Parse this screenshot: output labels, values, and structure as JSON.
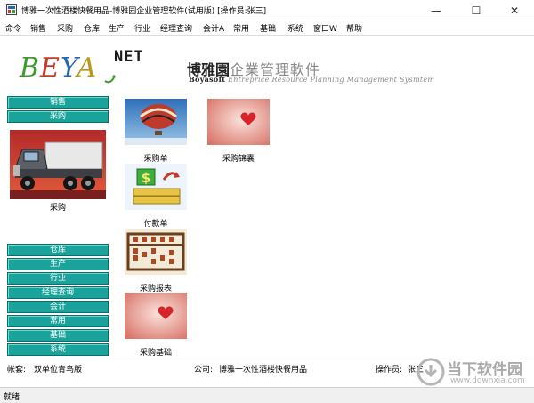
{
  "window": {
    "title": "博雅一次性酒楼快餐用品-博雅园企业管理软件(试用版) [操作员:张三]",
    "minimize_glyph": "—",
    "maximize_glyph": "☐",
    "close_glyph": "✕"
  },
  "menu": {
    "items": [
      "命令",
      "销售",
      "采购",
      "仓库",
      "生产",
      "行业",
      "经理查询",
      "会计A",
      "常用",
      "基础",
      "系统",
      "窗口W",
      "帮助"
    ]
  },
  "banner": {
    "logo_b": "B",
    "logo_e": "E",
    "logo_y": "Y",
    "logo_a": "A",
    "logo_net": "NET",
    "brand_zh_first": "博雅園",
    "brand_zh_rest": "企業管理軟件",
    "brand_en_first": "Boyasoft",
    "brand_en_rest": "Entreprice Resource Planning Management Sysmtem"
  },
  "sidebar": {
    "top_items": [
      "销售",
      "采购"
    ],
    "panel_label": "采购",
    "bottom_items": [
      "仓库",
      "生产",
      "行业",
      "经理查询",
      "会计",
      "常用",
      "基础",
      "系统"
    ]
  },
  "tiles": [
    {
      "label": "采购单",
      "icon": "balloon-icon"
    },
    {
      "label": "采购锦囊",
      "icon": "heart-icon"
    },
    {
      "label": "付款单",
      "icon": "dollar-money-icon"
    },
    {
      "label": "采购报表",
      "icon": "abacus-icon"
    },
    {
      "label": "采购基础",
      "icon": "heart-icon"
    }
  ],
  "status": {
    "account_label": "帐套:",
    "account_value": "双单位青鸟版",
    "company_label": "公司:",
    "company_value": "博雅一次性酒楼快餐用品",
    "operator_label": "操作员:",
    "operator_value": "张三",
    "ready_text": "就绪"
  },
  "watermark": {
    "name": "当下软件园",
    "url": "www.downxia.com"
  },
  "colors": {
    "sidebar_button": "#1aa39b",
    "sidebar_button_text": "#ffffff"
  }
}
